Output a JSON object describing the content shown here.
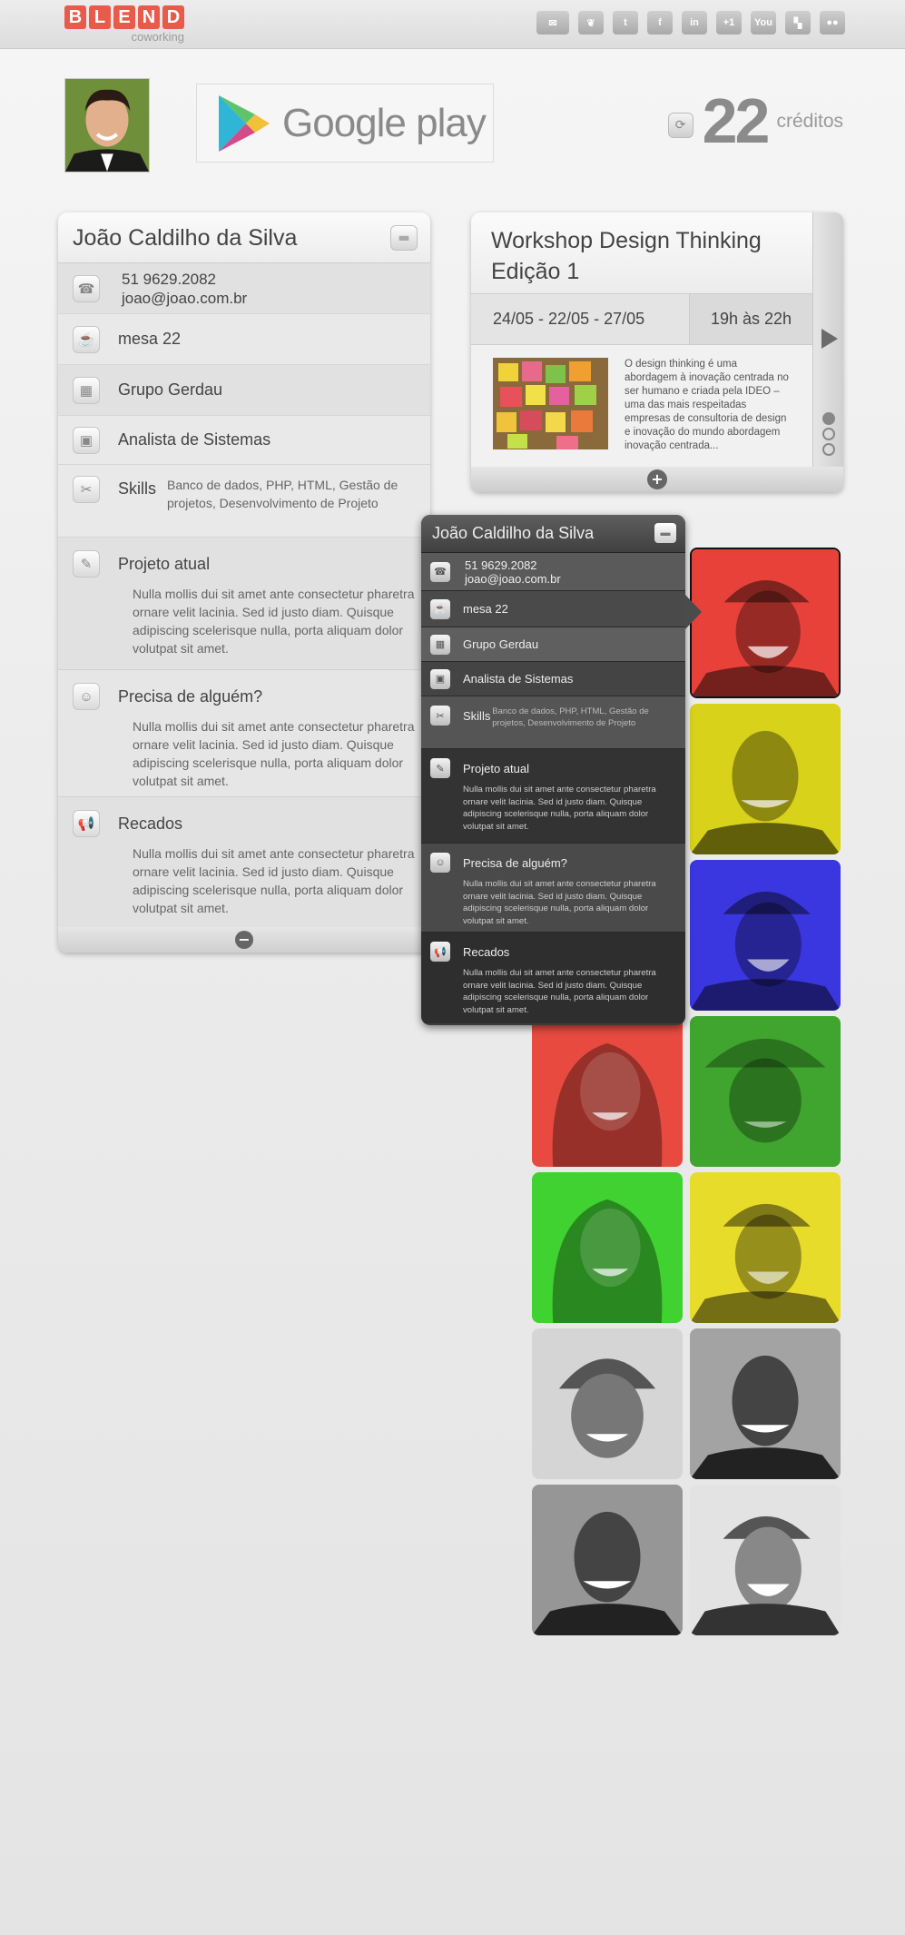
{
  "brand": {
    "letters": [
      "B",
      "L",
      "E",
      "N",
      "D"
    ],
    "subtitle": "coworking",
    "accent": "#e85b4a"
  },
  "social": [
    {
      "name": "mail-icon",
      "glyph": "✉"
    },
    {
      "name": "bird-icon",
      "glyph": "❦"
    },
    {
      "name": "twitter-icon",
      "glyph": "t"
    },
    {
      "name": "facebook-icon",
      "glyph": "f"
    },
    {
      "name": "linkedin-icon",
      "glyph": "in"
    },
    {
      "name": "plus-one-icon",
      "glyph": "+1"
    },
    {
      "name": "youtube-icon",
      "glyph": "You"
    },
    {
      "name": "delicious-icon",
      "glyph": "▚"
    },
    {
      "name": "flickr-icon",
      "glyph": "●●"
    }
  ],
  "store": {
    "label": "Google play"
  },
  "credits": {
    "value": "22",
    "label": "créditos"
  },
  "profile": {
    "name": "João Caldilho da Silva",
    "phone": "51 9629.2082",
    "email": "joao@joao.com.br",
    "desk": "mesa 22",
    "group": "Grupo Gerdau",
    "role": "Analista de Sistemas",
    "skills_label": "Skills",
    "skills_value": "Banco de dados, PHP, HTML, Gestão de projetos, Desenvolvimento de Projeto",
    "sections": [
      {
        "title": "Projeto atual",
        "text": "Nulla mollis dui sit amet ante consectetur pharetra ornare velit lacinia. Sed id justo diam. Quisque adipiscing scelerisque nulla, porta aliquam dolor volutpat sit amet."
      },
      {
        "title": "Precisa de alguém?",
        "text": "Nulla mollis dui sit amet ante consectetur pharetra ornare velit lacinia. Sed id justo diam. Quisque adipiscing scelerisque nulla, porta aliquam dolor volutpat sit amet."
      },
      {
        "title": "Recados",
        "text": "Nulla mollis dui sit amet ante consectetur pharetra ornare velit lacinia. Sed id justo diam. Quisque adipiscing scelerisque nulla, porta aliquam dolor volutpat sit amet."
      }
    ]
  },
  "workshop": {
    "title": "Workshop Design Thinking Edição 1",
    "dates": "24/05 - 22/05 - 27/05",
    "time": "19h às 22h",
    "description": "O design thinking é uma abordagem à inovação centrada no ser humano e criada pela IDEO – uma das mais respeitadas empresas de consultoria de design e inovação do mundo abordagem inovação centrada..."
  },
  "faces": [
    {
      "tint": "#e8413a"
    },
    {
      "tint": "#d9d21a"
    },
    {
      "tint": "#3b37e0"
    },
    {
      "tint": "#e84a3f"
    },
    {
      "tint": "#3fa52e"
    },
    {
      "tint": "#3fd230"
    },
    {
      "tint": "#e8dc2a"
    },
    {
      "tint": "#8a8a8a"
    },
    {
      "tint": "#6d6d6d"
    },
    {
      "tint": "#6a6a6a"
    },
    {
      "tint": "#8c8c8c"
    }
  ]
}
